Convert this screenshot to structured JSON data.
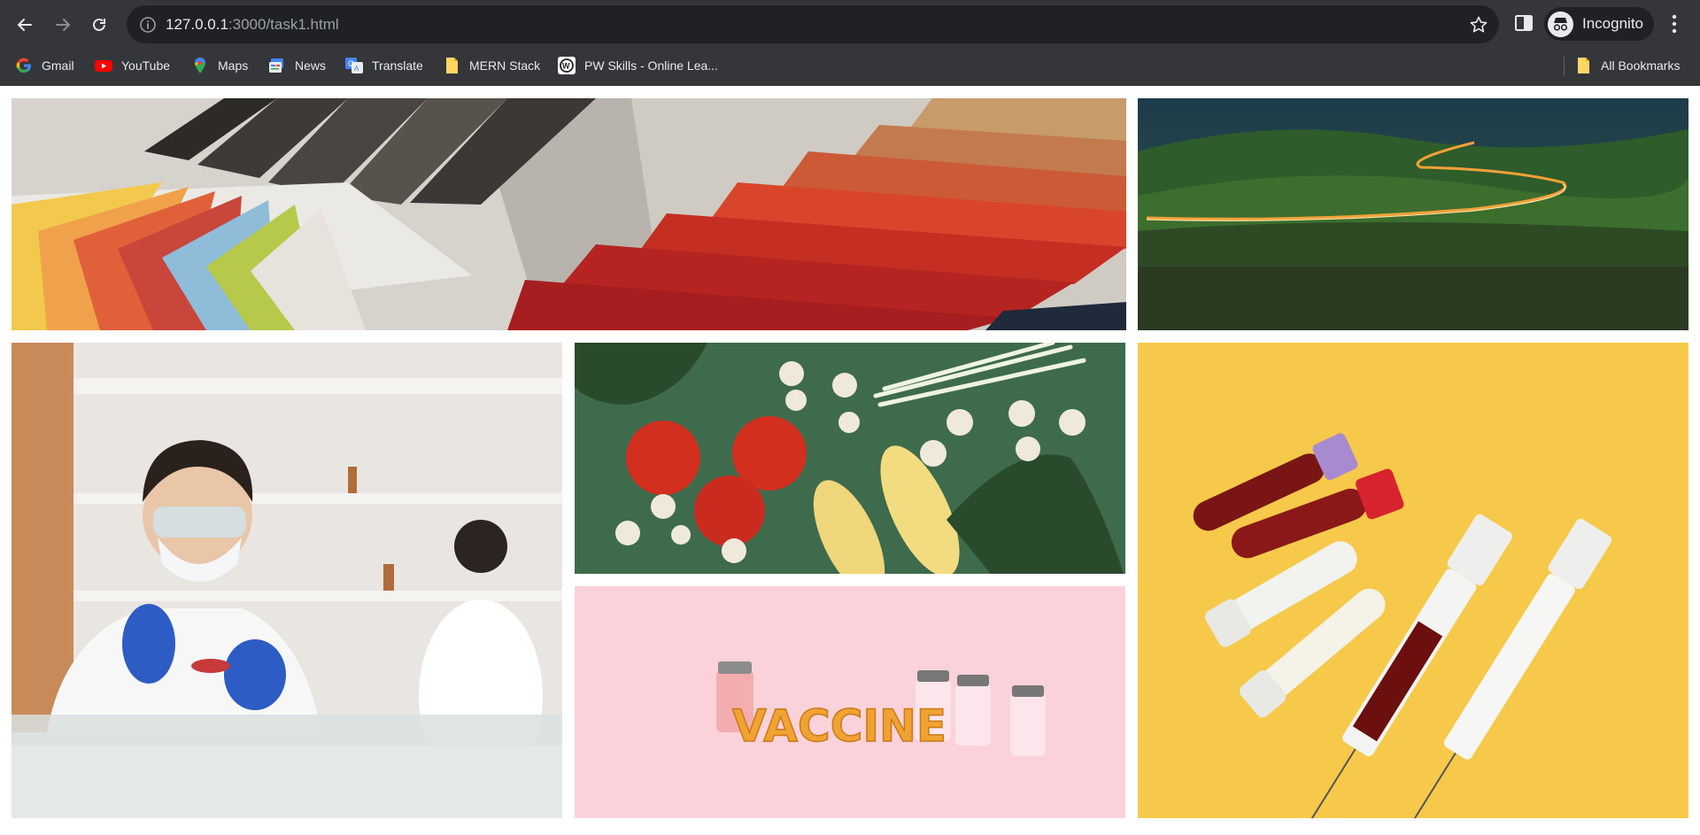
{
  "browser": {
    "url_host": "127.0.0.1",
    "url_rest": ":3000/task1.html",
    "profile_label": "Incognito",
    "icons": {
      "back": "arrow-left-icon",
      "forward": "arrow-right-icon",
      "reload": "reload-icon",
      "site_info": "info-icon",
      "bookmark_star": "star-icon",
      "side_panel": "side-panel-icon",
      "incognito": "incognito-icon",
      "menu": "kebab-menu-icon"
    }
  },
  "bookmarks": {
    "items": [
      {
        "label": "Gmail",
        "icon": "google-icon"
      },
      {
        "label": "YouTube",
        "icon": "youtube-icon"
      },
      {
        "label": "Maps",
        "icon": "maps-pin-icon"
      },
      {
        "label": "News",
        "icon": "news-icon"
      },
      {
        "label": "Translate",
        "icon": "translate-icon"
      },
      {
        "label": "MERN Stack",
        "icon": "folder-icon"
      },
      {
        "label": "PW Skills - Online Lea...",
        "icon": "pw-skills-icon"
      }
    ],
    "all_bookmarks_label": "All Bookmarks"
  },
  "gallery": {
    "images": [
      {
        "subject": "fabric and color swatches"
      },
      {
        "subject": "winding road light trails on green hills"
      },
      {
        "subject": "scientist in laboratory"
      },
      {
        "subject": "vegetables on green background"
      },
      {
        "subject": "blood sample tubes and syringes"
      },
      {
        "subject": "vaccine vials on pink background",
        "caption": "VACCINE"
      }
    ]
  },
  "colors": {
    "chrome_bg": "#35363a",
    "omnibox_bg": "#202124",
    "text_light": "#e8eaed"
  }
}
